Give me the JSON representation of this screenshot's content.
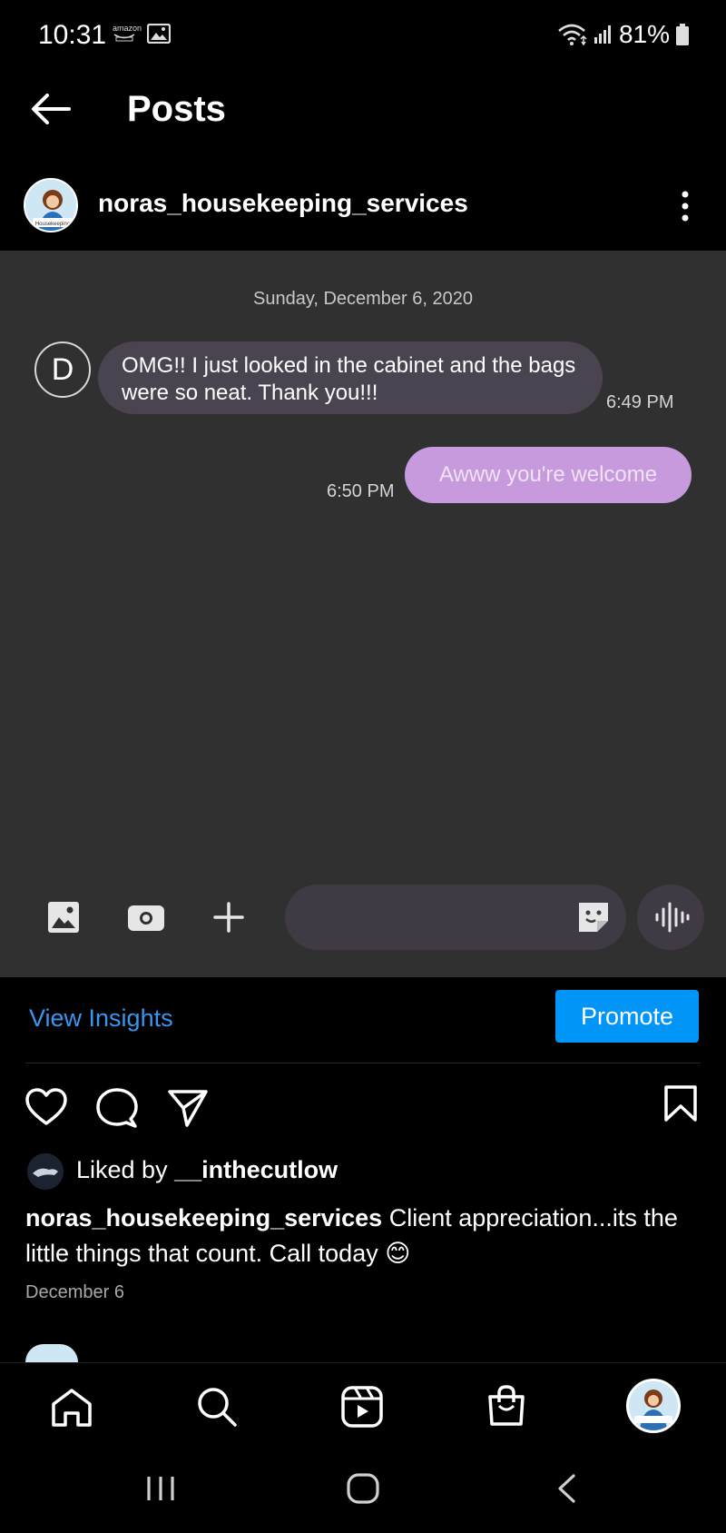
{
  "status_bar": {
    "time": "10:31",
    "notification_label": "amazon",
    "battery": "81%"
  },
  "header": {
    "title": "Posts"
  },
  "account": {
    "username": "noras_housekeeping_services",
    "avatar_label": "Housekeeping"
  },
  "chat": {
    "date": "Sunday, December 6, 2020",
    "sender_initial": "D",
    "messages": [
      {
        "text": "OMG!! I just looked in the cabinet and the bags were so neat. Thank you!!!",
        "time": "6:49 PM",
        "direction": "incoming"
      },
      {
        "text": "Awww you're welcome",
        "time": "6:50 PM",
        "direction": "outgoing"
      }
    ]
  },
  "post": {
    "view_insights": "View Insights",
    "promote": "Promote",
    "liked_prefix": "Liked by ",
    "liked_user": "__inthecutlow",
    "caption_user": "noras_housekeeping_services",
    "caption_text": " Client appreciation...its the little things that count. Call today 😊",
    "date": "December 6"
  },
  "colors": {
    "accent_blue": "#0095f6",
    "link_blue": "#3797f0",
    "outgoing_bubble": "#c79ade",
    "incoming_bubble": "#4a4450",
    "chat_bg": "#303030"
  },
  "icons": {
    "status": [
      "amazon-notification-icon",
      "gallery-notification-icon",
      "wifi-icon",
      "signal-icon",
      "battery-icon"
    ],
    "chat_toolbar": [
      "gallery-icon",
      "camera-icon",
      "plus-icon",
      "sticker-icon",
      "voice-icon"
    ],
    "post_actions": [
      "heart-icon",
      "comment-icon",
      "share-icon",
      "bookmark-icon"
    ],
    "bottom_nav": [
      "home-icon",
      "search-icon",
      "reels-icon",
      "shop-icon",
      "profile-avatar"
    ],
    "system_nav": [
      "recents-icon",
      "home-pill-icon",
      "back-chevron-icon"
    ]
  }
}
